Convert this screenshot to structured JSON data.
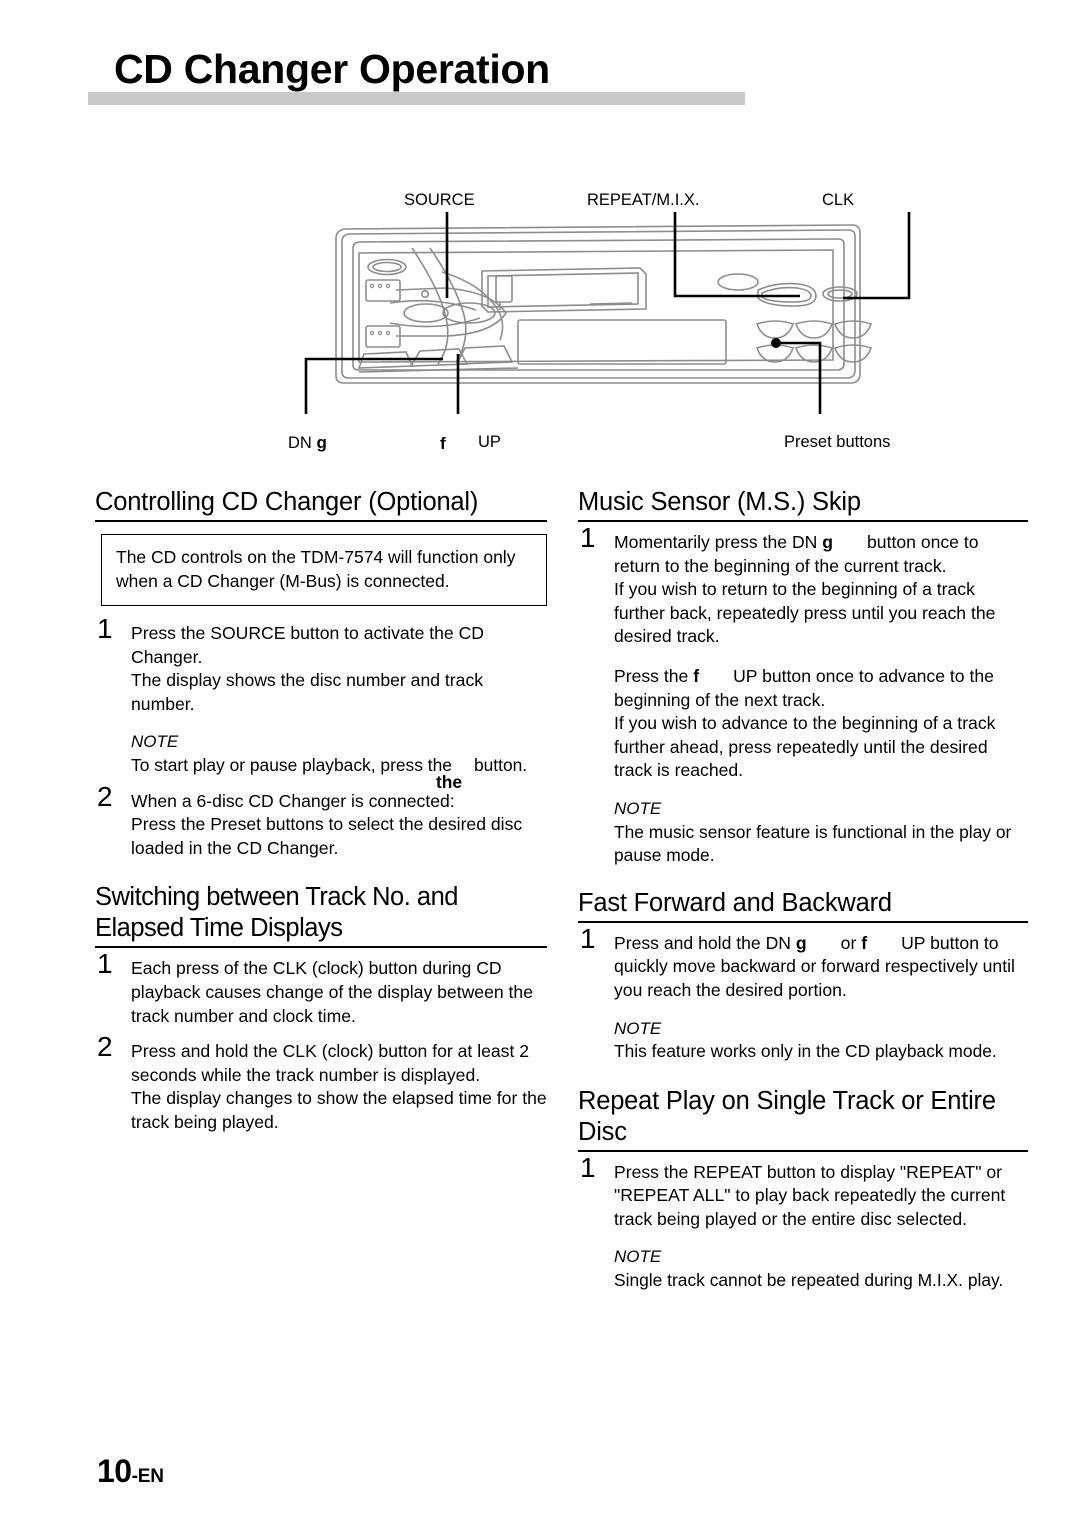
{
  "page": {
    "title": "CD Changer Operation",
    "footer_page_number": "10",
    "footer_language": "-EN"
  },
  "diagram": {
    "name": "head-unit-front-panel",
    "callouts": {
      "source": "SOURCE",
      "repeat_mix": "REPEAT/M.I.X.",
      "clk": "CLK",
      "dn_label": "DN",
      "dn_symbol": "g",
      "up_symbol": "f",
      "up_label": "UP",
      "preset_buttons": "Preset buttons"
    }
  },
  "left_column": {
    "section1": {
      "heading": "Controlling CD Changer (Optional)",
      "notice": "The CD controls on the TDM-7574 will function only when a CD Changer (M-Bus) is connected.",
      "steps": [
        {
          "number": "1",
          "lines": [
            "Press the SOURCE button to activate the CD Changer.",
            "The display shows the disc number and track number."
          ],
          "note_label": "NOTE",
          "note_prefix": "To start play or pause playback, press the",
          "note_symbol": "the",
          "note_suffix": "button."
        },
        {
          "number": "2",
          "lines": [
            "When a 6-disc CD Changer is connected:",
            "Press the Preset  buttons  to select the desired disc loaded in the CD Changer."
          ]
        }
      ]
    },
    "section2": {
      "heading": "Switching between Track No. and Elapsed Time Displays",
      "steps": [
        {
          "number": "1",
          "lines": [
            "Each press of the CLK  (clock) button during CD playback causes change of the display between the track number and clock time."
          ]
        },
        {
          "number": "2",
          "lines": [
            "Press and hold the CLK  (clock) button for at least 2 seconds while the track number is displayed.",
            "The display changes to show the elapsed time for the track being played."
          ]
        }
      ]
    }
  },
  "right_column": {
    "section1": {
      "heading": "Music Sensor (M.S.) Skip",
      "step_number": "1",
      "p1_prefix": "Momentarily press the DN",
      "p1_symbol": "g",
      "p1_suffix": "button once to return to the beginning of the current track.",
      "p2": "If you wish to return to the beginning of a track further back, repeatedly press until you reach the desired track.",
      "p3_prefix": "Press the",
      "p3_symbol": "f",
      "p3_suffix": "UP button once to advance to the beginning of the next track.",
      "p4": "If you wish to advance to the beginning of a track further ahead, press repeatedly until the desired track is reached.",
      "note_label": "NOTE",
      "note_body": "The music sensor feature is functional in the play or pause mode."
    },
    "section2": {
      "heading": "Fast Forward and Backward",
      "step_number": "1",
      "p1_prefix": "Press and hold the DN",
      "p1_symbol_a": "g",
      "p1_middle": "or",
      "p1_symbol_b": "f",
      "p1_suffix": "UP button to quickly move backward or forward respectively until you reach the desired portion.",
      "note_label": "NOTE",
      "note_body": "This feature works only in the CD playback mode."
    },
    "section3": {
      "heading": "Repeat Play on Single Track or Entire Disc",
      "step_number": "1",
      "p1": "Press the REPEAT  button to display \"REPEAT\" or \"REPEAT ALL\" to play back repeatedly the current track being played or the entire disc selected.",
      "note_label": "NOTE",
      "note_body": "Single track cannot be repeated during M.I.X. play."
    }
  },
  "colors": {
    "title_rule": "#c9c9c9",
    "text": "#000000",
    "diagram_line": "#8d8d8d"
  }
}
